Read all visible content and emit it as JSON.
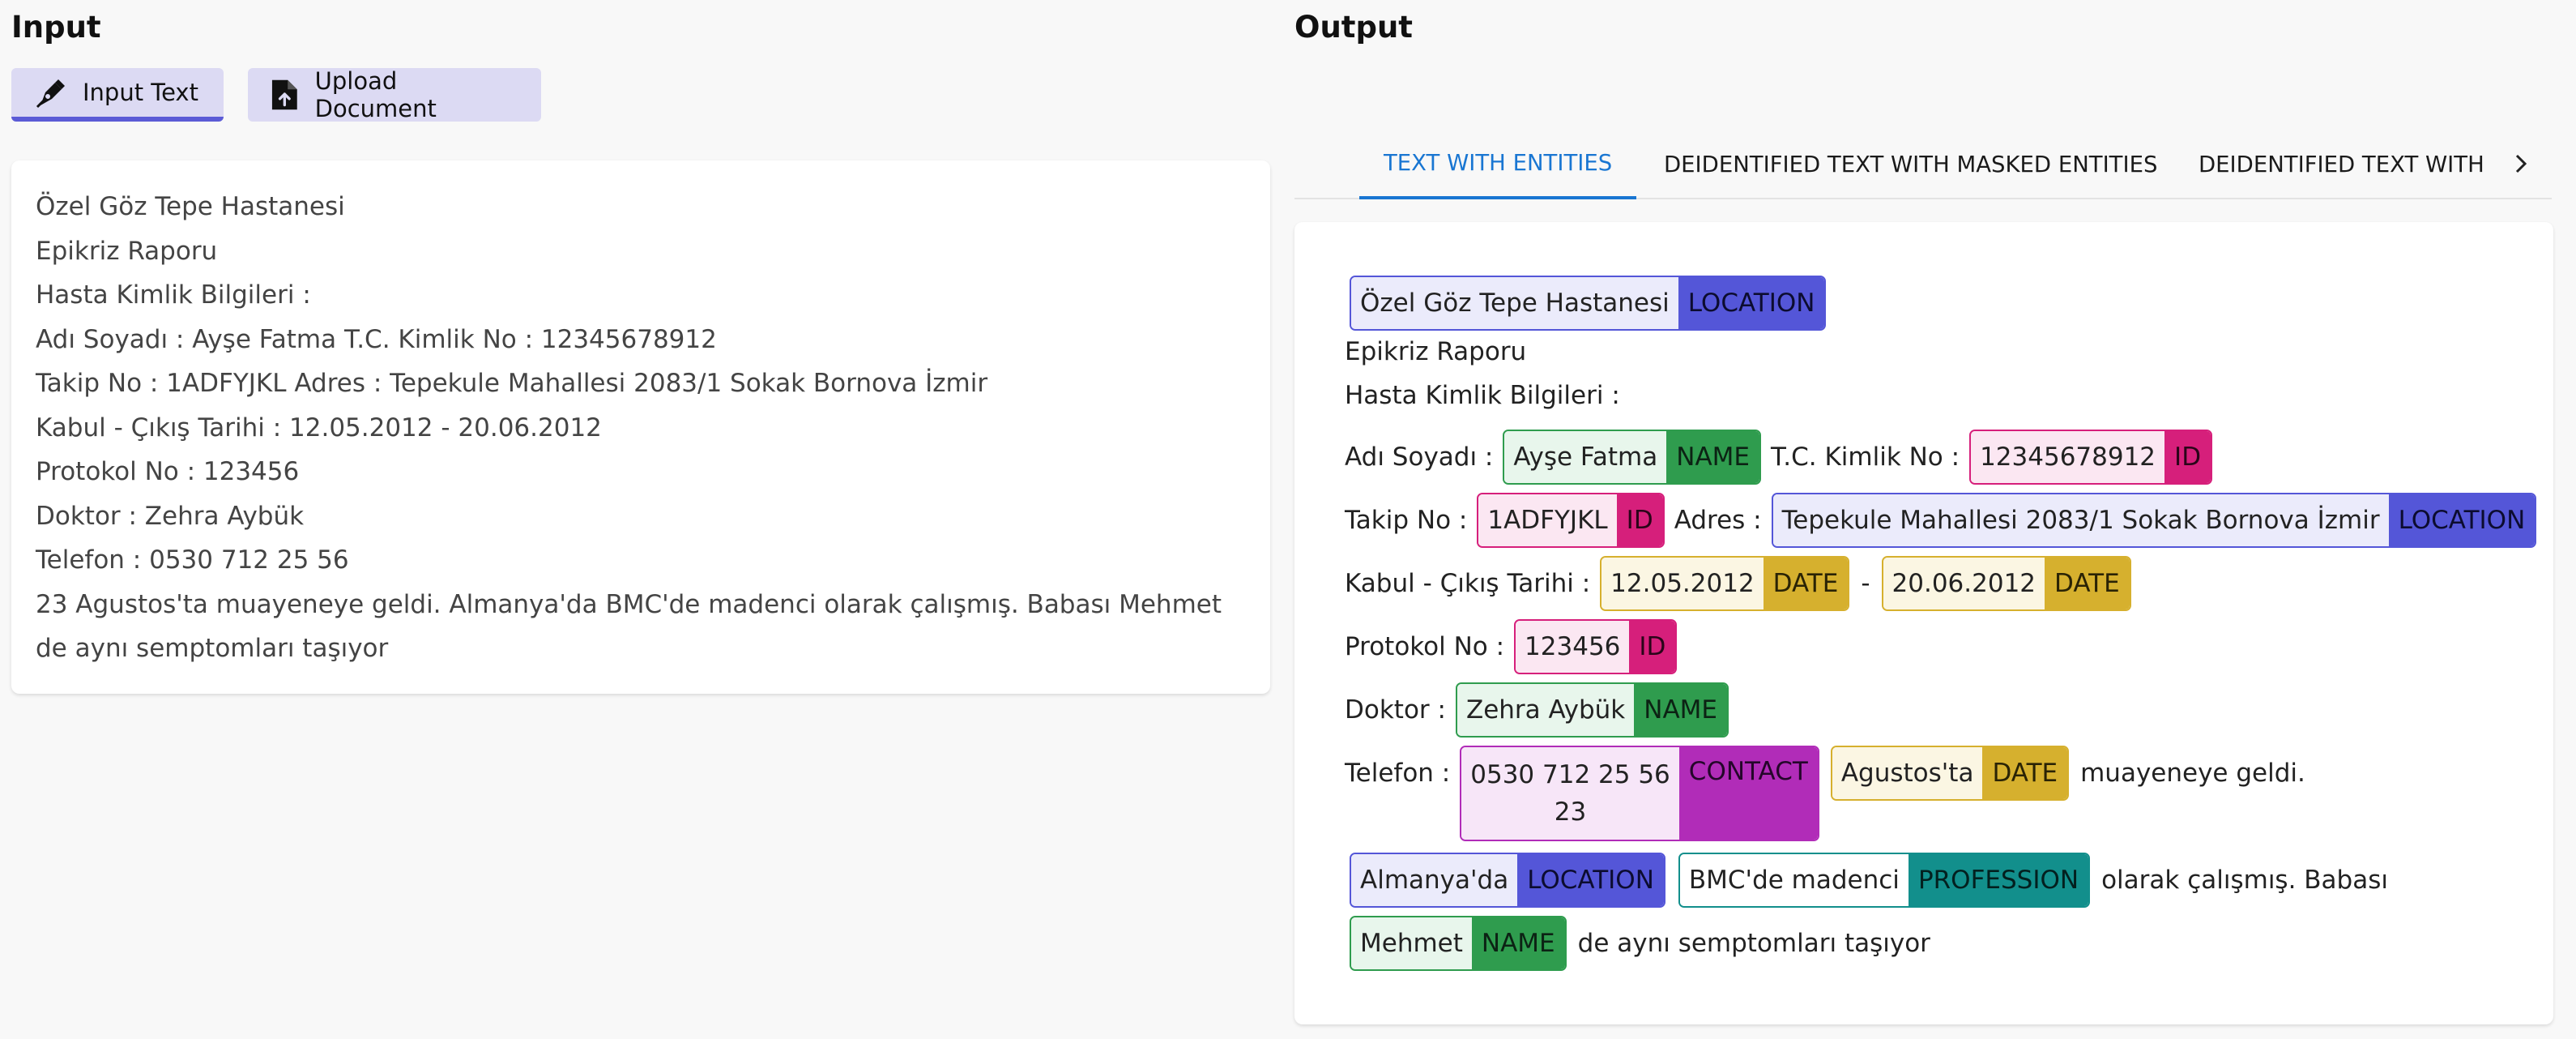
{
  "input": {
    "title": "Input",
    "buttons": {
      "input_text": "Input Text",
      "upload_document": "Upload Document"
    },
    "lines": [
      "Özel Göz Tepe Hastanesi",
      "Epikriz Raporu",
      "Hasta Kimlik Bilgileri :",
      "Adı Soyadı : Ayşe Fatma T.C. Kimlik No : 12345678912",
      "Takip No : 1ADFYJKL Adres : Tepekule Mahallesi 2083/1 Sokak Bornova İzmir",
      "Kabul - Çıkış Tarihi : 12.05.2012 - 20.06.2012",
      "Protokol No : 123456",
      "Doktor : Zehra Aybük",
      "Telefon : 0530 712 25 56",
      "23 Agustos'ta muayeneye geldi. Almanya'da BMC'de madenci olarak çalışmış. Babası Mehmet de aynı semptomları taşıyor"
    ]
  },
  "output": {
    "title": "Output",
    "tabs": [
      {
        "label": "TEXT WITH ENTITIES"
      },
      {
        "label": "DEIDENTIFIED TEXT WITH MASKED ENTITIES"
      },
      {
        "label": "DEIDENTIFIED TEXT WITH"
      }
    ],
    "entities": {
      "hospital": {
        "value": "Özel Göz Tepe Hastanesi",
        "label": "LOCATION"
      },
      "name1": {
        "value": "Ayşe Fatma",
        "label": "NAME"
      },
      "tc": {
        "value": "12345678912",
        "label": "ID"
      },
      "takip": {
        "value": "1ADFYJKL",
        "label": "ID"
      },
      "address": {
        "value": "Tepekule Mahallesi 2083/1 Sokak Bornova İzmir",
        "label": "LOCATION"
      },
      "date1": {
        "value": "12.05.2012",
        "label": "DATE"
      },
      "date2": {
        "value": "20.06.2012",
        "label": "DATE"
      },
      "protokol": {
        "value": "123456",
        "label": "ID"
      },
      "doctor": {
        "value": "Zehra Aybük",
        "label": "NAME"
      },
      "contact": {
        "value_line1": "0530 712 25 56",
        "value_line2": "23",
        "label": "CONTACT"
      },
      "date3": {
        "value": "Agustos'ta",
        "label": "DATE"
      },
      "country": {
        "value": "Almanya'da",
        "label": "LOCATION"
      },
      "profession": {
        "value": "BMC'de madenci",
        "label": "PROFESSION"
      },
      "name3": {
        "value": "Mehmet",
        "label": "NAME"
      }
    },
    "text": {
      "epikriz": "Epikriz Raporu",
      "hasta": "Hasta Kimlik Bilgileri :",
      "adi": "Adı Soyadı :",
      "tc_label": "T.C. Kimlik No :",
      "takip_label": "Takip No :",
      "adres_label": "Adres :",
      "kabul_label": "Kabul - Çıkış Tarihi :",
      "dash": "-",
      "protokol_label": "Protokol No :",
      "doktor_label": "Doktor :",
      "telefon_label": "Telefon :",
      "muayene": "muayeneye geldi.",
      "olarak": "olarak çalışmış. Babası",
      "semptom": "de aynı semptomları taşıyor"
    },
    "colors": {
      "LOCATION": "#5456d8",
      "NAME": "#2f9c4e",
      "ID": "#d61f7b",
      "DATE": "#d6b02e",
      "CONTACT": "#b12cb8",
      "PROFESSION": "#128f8c",
      "active_tab": "#1976d2"
    }
  },
  "icons": {
    "input_text": "pen-nib-icon",
    "upload_document": "file-upload-icon",
    "tab_scroll": "chevron-right-icon"
  }
}
